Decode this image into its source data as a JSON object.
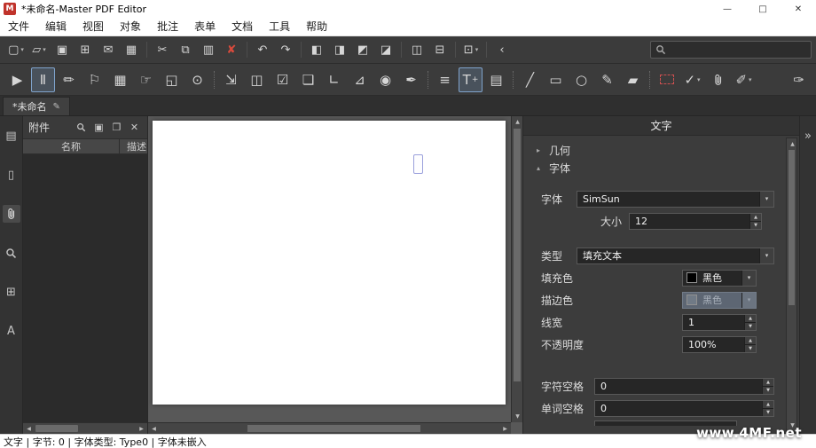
{
  "window": {
    "title": "*未命名-Master PDF Editor",
    "logo_letter": "M",
    "minimize": "—",
    "maximize": "□",
    "close": "✕"
  },
  "menubar": {
    "items": [
      "文件",
      "编辑",
      "视图",
      "对象",
      "批注",
      "表单",
      "文档",
      "工具",
      "帮助"
    ]
  },
  "ui": {
    "caret": "▾",
    "plus": "+",
    "spin_up": "▲",
    "spin_down": "▼",
    "scroll_up": "▲",
    "scroll_down": "▼",
    "scroll_left": "◀",
    "scroll_right": "▶",
    "section_collapsed": "▸",
    "section_expanded": "▴",
    "tab_edit": "✎",
    "panel_collapse": "»"
  },
  "toolbar_main": {
    "buttons": [
      {
        "name": "new-document",
        "glyph": "▢"
      },
      {
        "name": "open-file",
        "glyph": "▱"
      },
      {
        "name": "save",
        "glyph": "▣"
      },
      {
        "name": "save-all",
        "glyph": "⊞"
      },
      {
        "name": "email",
        "glyph": "✉"
      },
      {
        "name": "print",
        "glyph": "▦"
      },
      {
        "name": "cut",
        "glyph": "✂"
      },
      {
        "name": "copy",
        "glyph": "⧉"
      },
      {
        "name": "paste",
        "glyph": "▥"
      },
      {
        "name": "delete",
        "glyph": "✘"
      },
      {
        "name": "undo",
        "glyph": "↶"
      },
      {
        "name": "redo",
        "glyph": "↷"
      },
      {
        "name": "align-left",
        "glyph": "◧"
      },
      {
        "name": "align-right",
        "glyph": "◨"
      },
      {
        "name": "align-top",
        "glyph": "◩"
      },
      {
        "name": "align-bottom",
        "glyph": "◪"
      },
      {
        "name": "distribute-horizontal",
        "glyph": "◫"
      },
      {
        "name": "distribute-vertical",
        "glyph": "⊟"
      },
      {
        "name": "fit-page",
        "glyph": "⊡"
      },
      {
        "name": "navigate-back",
        "glyph": "‹"
      }
    ]
  },
  "search": {
    "value": ""
  },
  "toolbar_edit": {
    "buttons": [
      {
        "name": "select-tool",
        "glyph": "▶"
      },
      {
        "name": "edit-text-tool",
        "glyph": "Ⅱ"
      },
      {
        "name": "edit-object-tool",
        "glyph": "✏"
      },
      {
        "name": "select-area-tool",
        "glyph": "⚐"
      },
      {
        "name": "edit-forms-tool",
        "glyph": "▦"
      },
      {
        "name": "hand-tool",
        "glyph": "☞"
      },
      {
        "name": "crop-tool",
        "glyph": "◱"
      },
      {
        "name": "snapshot-tool",
        "glyph": "⊙"
      },
      {
        "name": "link-tool",
        "glyph": "⇲"
      },
      {
        "name": "media-tool",
        "glyph": "◫"
      },
      {
        "name": "checkbox-tool",
        "glyph": "☑"
      },
      {
        "name": "note-tool",
        "glyph": "❏"
      },
      {
        "name": "ruler-tool",
        "glyph": "∟"
      },
      {
        "name": "measure-tool",
        "glyph": "⊿"
      },
      {
        "name": "record-tool",
        "glyph": "◉"
      },
      {
        "name": "signature-tool",
        "glyph": "✒"
      },
      {
        "name": "line-sort-tool",
        "glyph": "≡"
      },
      {
        "name": "add-text-tool",
        "glyph": "T"
      },
      {
        "name": "add-image-tool",
        "glyph": "▤"
      },
      {
        "name": "line-tool",
        "glyph": "╱"
      },
      {
        "name": "rectangle-tool",
        "glyph": "▭"
      },
      {
        "name": "ellipse-tool",
        "glyph": "○"
      },
      {
        "name": "pencil-tool",
        "glyph": "✎"
      },
      {
        "name": "eraser-tool",
        "glyph": "▰"
      },
      {
        "name": "annotation-select-tool",
        "glyph": ""
      },
      {
        "name": "check-annotation-tool",
        "glyph": "✓"
      },
      {
        "name": "attach-file-tool",
        "glyph": "paperclip-svg"
      },
      {
        "name": "highlight-tool",
        "glyph": "✐"
      },
      {
        "name": "brush-tool",
        "glyph": "✑"
      }
    ]
  },
  "tabbar": {
    "tabs": [
      {
        "label": "*未命名"
      }
    ]
  },
  "sidebar": {
    "icons": [
      {
        "name": "pages",
        "glyph": "▤"
      },
      {
        "name": "thumbnails",
        "glyph": "▯"
      },
      {
        "name": "attachments",
        "glyph": "paperclip-svg"
      },
      {
        "name": "search",
        "glyph": "magnifier-svg"
      },
      {
        "name": "layers",
        "glyph": "⊞"
      },
      {
        "name": "fonts",
        "glyph": "A"
      }
    ]
  },
  "attachments_panel": {
    "title": "附件",
    "buttons": [
      {
        "name": "search-attachment",
        "glyph": "magnifier-svg"
      },
      {
        "name": "save-attachment",
        "glyph": "▣"
      },
      {
        "name": "open-attachment",
        "glyph": "❐"
      },
      {
        "name": "close-panel",
        "glyph": "✕"
      }
    ],
    "columns": [
      "名称",
      "描述"
    ],
    "rows": []
  },
  "properties": {
    "title": "文字",
    "sections": [
      {
        "label": "几何",
        "collapsed": true
      },
      {
        "label": "字体",
        "collapsed": false
      }
    ],
    "font": {
      "label": "字体",
      "value": "SimSun"
    },
    "size": {
      "label": "大小",
      "value": "12"
    },
    "type": {
      "label": "类型",
      "value": "填充文本"
    },
    "fill_color": {
      "label": "填充色",
      "value": "黑色",
      "swatch": "#000000",
      "swatch_style": "background:#000000"
    },
    "stroke_color": {
      "label": "描边色",
      "value": "黑色",
      "swatch": "#707a86",
      "swatch_style": "background:#707a86",
      "disabled": true
    },
    "line_width": {
      "label": "线宽",
      "value": "1"
    },
    "opacity": {
      "label": "不透明度",
      "value": "100%"
    },
    "char_spacing": {
      "label": "字符空格",
      "value": "0"
    },
    "word_spacing": {
      "label": "单词空格",
      "value": "0"
    }
  },
  "statusbar": {
    "text": "文字 | 字节: 0 | 字体类型: Type0 | 字体未嵌入"
  },
  "watermark": {
    "text": "www.4MF.net"
  },
  "colors": {
    "accent_red": "#c0332b",
    "selection_blue": "#7fa3cc",
    "page_white": "#ffffff"
  }
}
